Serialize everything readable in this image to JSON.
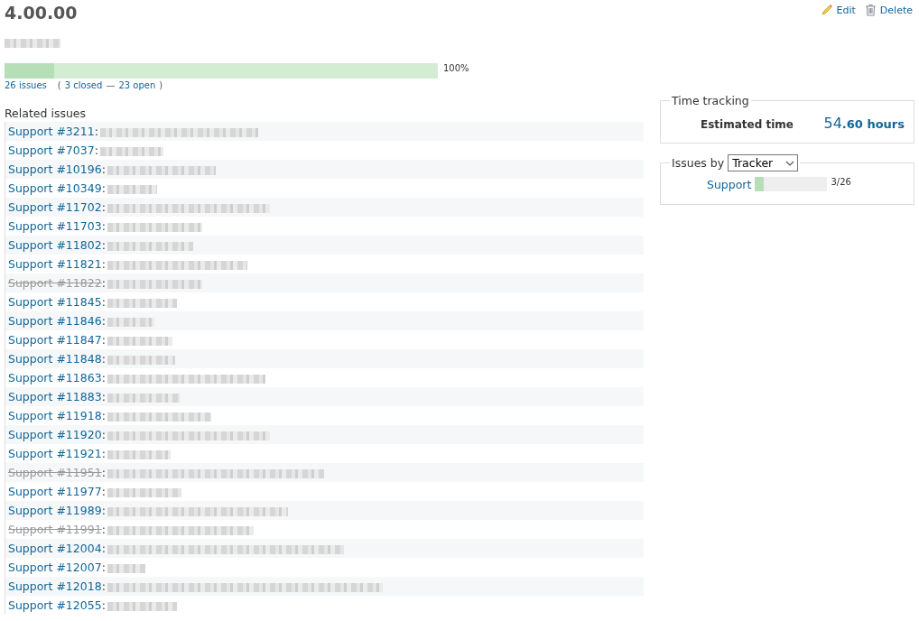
{
  "version": {
    "title": "4.00.00",
    "description_blurred": true
  },
  "actions": [
    {
      "kind": "edit",
      "label": "Edit"
    },
    {
      "kind": "delete",
      "label": "Delete"
    }
  ],
  "progress": {
    "closed": {
      "level": 0.115
    },
    "done": {
      "level": 1.0
    },
    "percent": "100%",
    "issues_link": "26 issues",
    "open_paren": "(",
    "closed_link": "3 closed",
    "dash": "—",
    "open_link": "23 open",
    "close_paren": ")"
  },
  "related_issues": {
    "title": "Related issues",
    "separator": ":",
    "rows": [
      {
        "issue": "Support #3211",
        "closed": false
      },
      {
        "issue": "Support #7037",
        "closed": false
      },
      {
        "issue": "Support #10196",
        "closed": false
      },
      {
        "issue": "Support #10349",
        "closed": false
      },
      {
        "issue": "Support #11702",
        "closed": false
      },
      {
        "issue": "Support #11703",
        "closed": false
      },
      {
        "issue": "Support #11802",
        "closed": false
      },
      {
        "issue": "Support #11821",
        "closed": false
      },
      {
        "issue": "Support #11822",
        "closed": true
      },
      {
        "issue": "Support #11845",
        "closed": false
      },
      {
        "issue": "Support #11846",
        "closed": false
      },
      {
        "issue": "Support #11847",
        "closed": false
      },
      {
        "issue": "Support #11848",
        "closed": false
      },
      {
        "issue": "Support #11863",
        "closed": false
      },
      {
        "issue": "Support #11883",
        "closed": false
      },
      {
        "issue": "Support #11918",
        "closed": false
      },
      {
        "issue": "Support #11920",
        "closed": false
      },
      {
        "issue": "Support #11921",
        "closed": false
      },
      {
        "issue": "Support #11951",
        "closed": true
      },
      {
        "issue": "Support #11977",
        "closed": false
      },
      {
        "issue": "Support #11989",
        "closed": false
      },
      {
        "issue": "Support #11991",
        "closed": true
      },
      {
        "issue": "Support #12004",
        "closed": false
      },
      {
        "issue": "Support #12007",
        "closed": false
      },
      {
        "issue": "Support #12018",
        "closed": false
      },
      {
        "issue": "Support #12055",
        "closed": false
      }
    ]
  },
  "time_tracking": {
    "legend": "Time tracking",
    "label": "Estimated time",
    "value_big": "54",
    "value_small": ".60 hours"
  },
  "issues_by": {
    "legend": "Issues by",
    "select": "Tracker",
    "rows": [
      {
        "name": "Support",
        "level": 0.115,
        "count": "3/26"
      }
    ]
  }
}
